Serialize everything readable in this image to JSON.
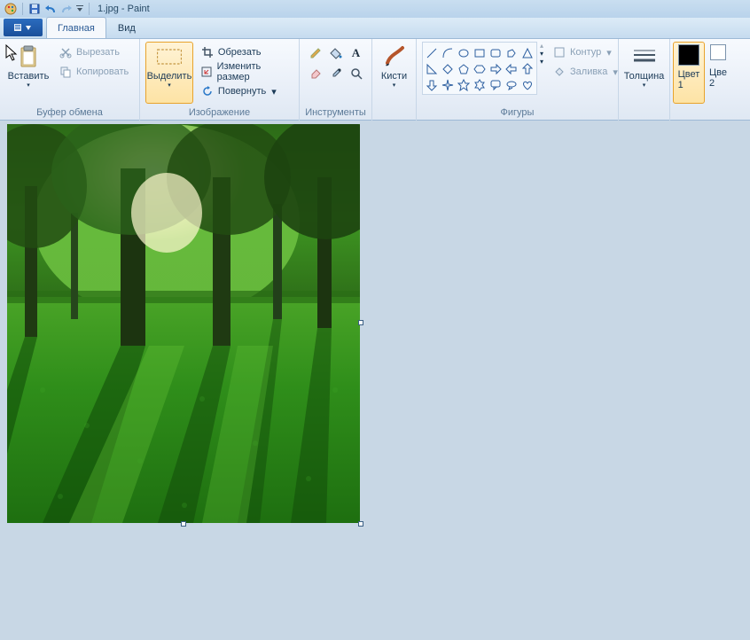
{
  "title": "1.jpg - Paint",
  "tabs": {
    "home": "Главная",
    "view": "Вид"
  },
  "groups": {
    "clipboard": {
      "label": "Буфер обмена",
      "paste": "Вставить",
      "cut": "Вырезать",
      "copy": "Копировать"
    },
    "image": {
      "label": "Изображение",
      "select": "Выделить",
      "crop": "Обрезать",
      "resize": "Изменить размер",
      "rotate": "Повернуть"
    },
    "tools": {
      "label": "Инструменты"
    },
    "brushes": {
      "label": "Кисти"
    },
    "shapes": {
      "label": "Фигуры",
      "outline": "Контур",
      "fill": "Заливка"
    },
    "thickness": {
      "label": "Толщина"
    },
    "colors": {
      "color1": "Цвет\n1",
      "color2": "Цве\n2"
    }
  },
  "colors": {
    "c1": "#000000",
    "c2": "#ffffff"
  }
}
